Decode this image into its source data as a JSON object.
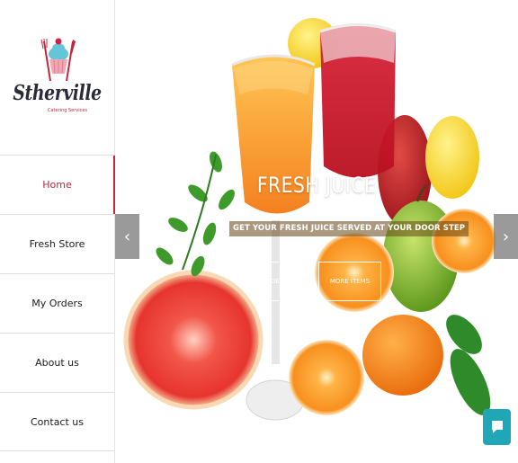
{
  "brand": {
    "name": "Stherville",
    "tagline": "Catering Services",
    "accent_color": "#c4253b",
    "logo_icon": "cupcake-icon"
  },
  "nav": {
    "items": [
      {
        "label": "Home",
        "active": true
      },
      {
        "label": "Fresh Store",
        "active": false
      },
      {
        "label": "My Orders",
        "active": false
      },
      {
        "label": "About us",
        "active": false
      },
      {
        "label": "Contact us",
        "active": false
      }
    ]
  },
  "hero": {
    "title": "FRESH JUICE",
    "subtitle": "GET YOUR FRESH JUICE SERVED AT YOUR DOOR STEP",
    "buttons": {
      "order": "ORDER NOW",
      "more": "MORE ITEMS"
    },
    "prev_icon": "chevron-left-icon",
    "next_icon": "chevron-right-icon"
  },
  "chat": {
    "icon": "chat-icon",
    "color": "#1fa7b7"
  }
}
